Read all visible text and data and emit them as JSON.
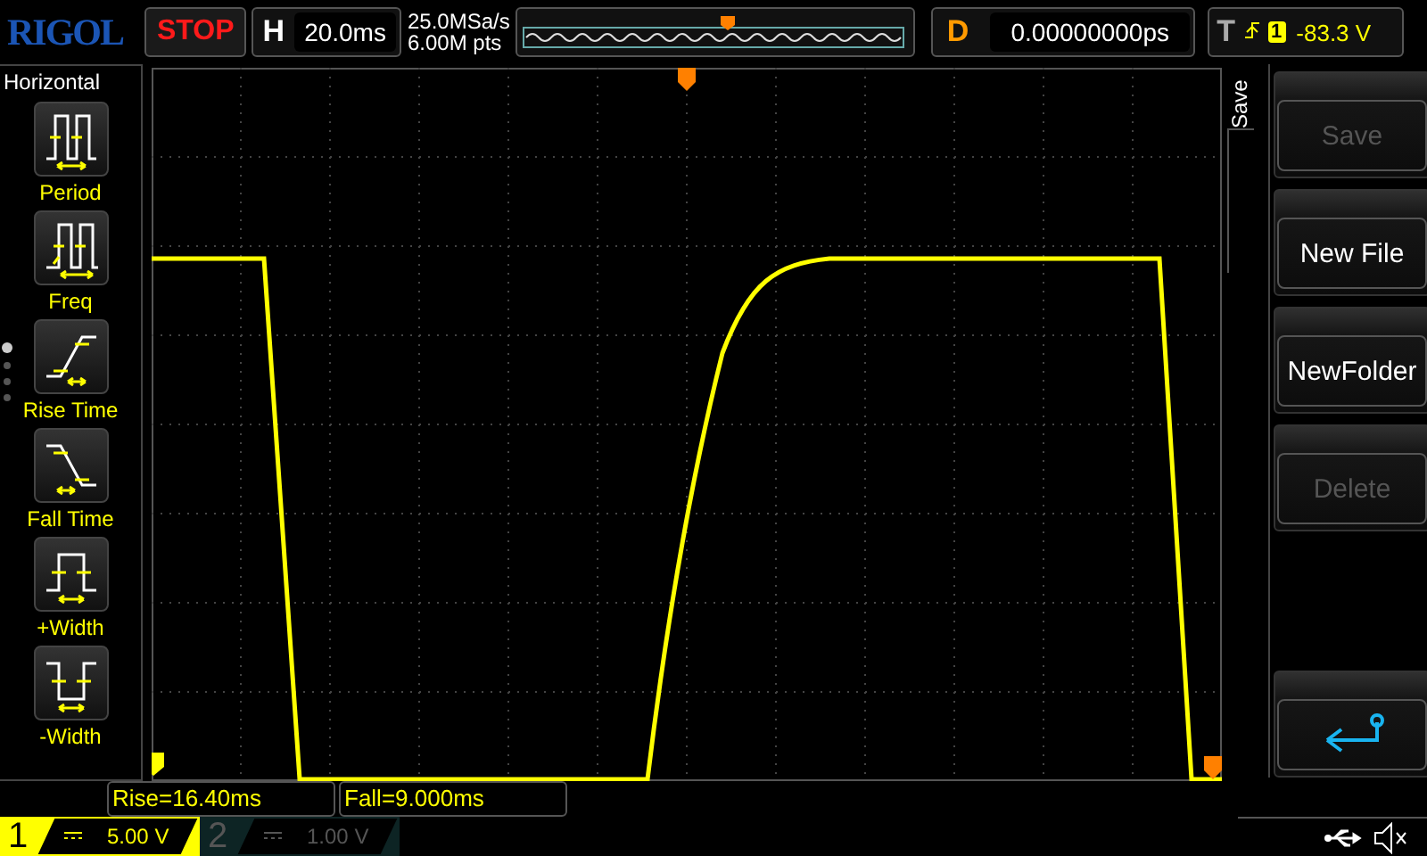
{
  "brand": "RIGOL",
  "run_state": "STOP",
  "timebase": {
    "label": "H",
    "value": "20.0ms"
  },
  "sample": {
    "rate": "25.0MSa/s",
    "depth": "6.00M pts"
  },
  "delay": {
    "label": "D",
    "value": "0.00000000ps"
  },
  "trigger": {
    "label": "T",
    "channel": "1",
    "level": "-83.3 V"
  },
  "measure_panel": {
    "title": "Horizontal",
    "page_dots": [
      {
        "selected": true
      },
      {
        "selected": false
      },
      {
        "selected": false
      },
      {
        "selected": false
      }
    ],
    "items": [
      {
        "label": "Period",
        "kind": "period"
      },
      {
        "label": "Freq",
        "kind": "freq"
      },
      {
        "label": "Rise Time",
        "kind": "rise"
      },
      {
        "label": "Fall Time",
        "kind": "fall"
      },
      {
        "label": "+Width",
        "kind": "pwidth"
      },
      {
        "label": "-Width",
        "kind": "nwidth"
      }
    ]
  },
  "menu": {
    "title": "Save",
    "items": [
      {
        "kind": "button",
        "label": "Save",
        "disabled": true
      },
      {
        "kind": "button",
        "label": "New File",
        "disabled": false
      },
      {
        "kind": "button",
        "label": "NewFolder",
        "disabled": false
      },
      {
        "kind": "button",
        "label": "Delete",
        "disabled": true
      },
      {
        "kind": "back"
      }
    ]
  },
  "measurements": [
    "Rise=16.40ms",
    "Fall=9.000ms"
  ],
  "channels": [
    {
      "number": "1",
      "scale": "5.00 V",
      "on": true
    },
    {
      "number": "2",
      "scale": "1.00 V",
      "on": false
    }
  ]
}
